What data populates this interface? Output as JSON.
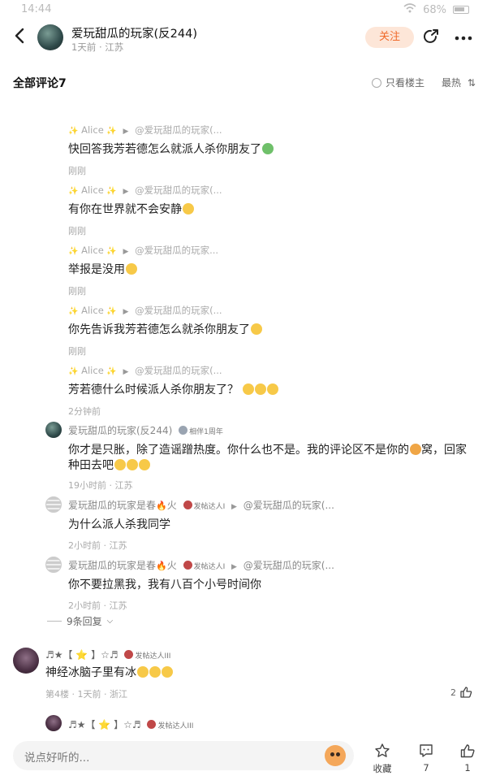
{
  "status": {
    "time": "14:44",
    "battery": "68%"
  },
  "header": {
    "name": "爱玩甜瓜的玩家(反244)",
    "sub": "1天前 · 江苏",
    "follow_label": "关注"
  },
  "section": {
    "title": "全部评论7",
    "only_op": "只看楼主",
    "sort": "最热"
  },
  "replies": [
    {
      "from": "Alice",
      "to": "@爱玩甜瓜的玩家(...",
      "text": "快回答我芳若德怎么就派人杀你朋友了",
      "meta": "刚刚",
      "emoji": "green"
    },
    {
      "from": "Alice",
      "to": "@爱玩甜瓜的玩家(...",
      "text": "有你在世界就不会安静",
      "meta": "刚刚",
      "emoji": "yellow"
    },
    {
      "from": "Alice",
      "to": "@爱玩甜瓜的玩家...",
      "text": "举报是没用",
      "meta": "刚刚",
      "emoji": "yellow"
    },
    {
      "from": "Alice",
      "to": "@爱玩甜瓜的玩家(...",
      "text": "你先告诉我芳若德怎么就杀你朋友了",
      "meta": "刚刚",
      "emoji": "yellow"
    },
    {
      "from": "Alice",
      "to": "@爱玩甜瓜的玩家(...",
      "text": "芳若德什么时候派人杀你朋友了？",
      "meta": "2分钟前",
      "emoji": "triple"
    }
  ],
  "op_reply": {
    "name": "爱玩甜瓜的玩家(反244)",
    "badge": "相伴1周年",
    "text_line1": "你才是只胀，除了造谣蹭热度。你什么也不是。我的评论区不是你的",
    "text_line1b": "窝，回家",
    "text_line2": "种田去吧",
    "meta": "19小时前 · 江苏"
  },
  "spring_replies": [
    {
      "name": "爱玩甜瓜的玩家是春",
      "fire": "火",
      "badge": "发帖达人I",
      "to": "@爱玩甜瓜的玩家(...",
      "text": "为什么派人杀我同学",
      "meta": "2小时前 · 江苏"
    },
    {
      "name": "爱玩甜瓜的玩家是春",
      "fire": "火",
      "badge": "发帖达人I",
      "to": "@爱玩甜瓜的玩家(...",
      "text": "你不要拉黑我，我有八百个小号时间你",
      "meta": "2小时前 · 江苏"
    }
  ],
  "expand_label": "9条回复",
  "floor4": {
    "name": "♬★【 ⭐ 】☆♬",
    "badge": "发帖达人III",
    "text": "神经冰脑子里有冰",
    "meta": "第4楼 · 1天前 · 浙江",
    "likes": "2"
  },
  "floor5": {
    "name": "♬★【 ⭐ 】☆♬",
    "badge": "发帖达人III"
  },
  "bottom": {
    "placeholder": "说点好听的...",
    "collect": "收藏",
    "comments": "7",
    "likes": "1"
  }
}
